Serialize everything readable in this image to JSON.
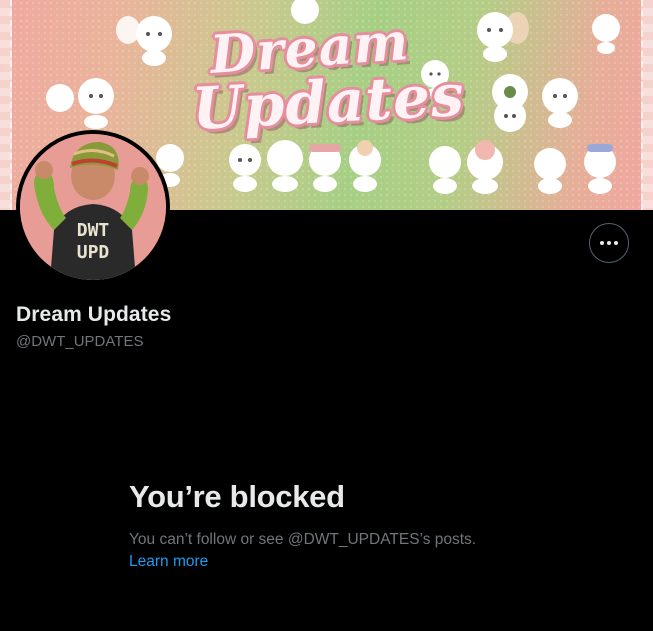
{
  "profile": {
    "display_name": "Dream Updates",
    "handle": "@DWT_UPDATES",
    "avatar_text": [
      "DWT",
      "UPD"
    ]
  },
  "banner": {
    "title_line1": "Dream",
    "title_line2": "Updates"
  },
  "blocked": {
    "title": "You’re blocked",
    "description": "You can’t follow or see @DWT_UPDATES’s posts.",
    "learn_more": "Learn more"
  },
  "icons": {
    "more": "more-horizontal-icon"
  },
  "colors": {
    "background": "#000000",
    "primary_text": "#e7e9ea",
    "secondary_text": "#71767b",
    "link": "#1d9bf0",
    "button_border": "#536471"
  }
}
